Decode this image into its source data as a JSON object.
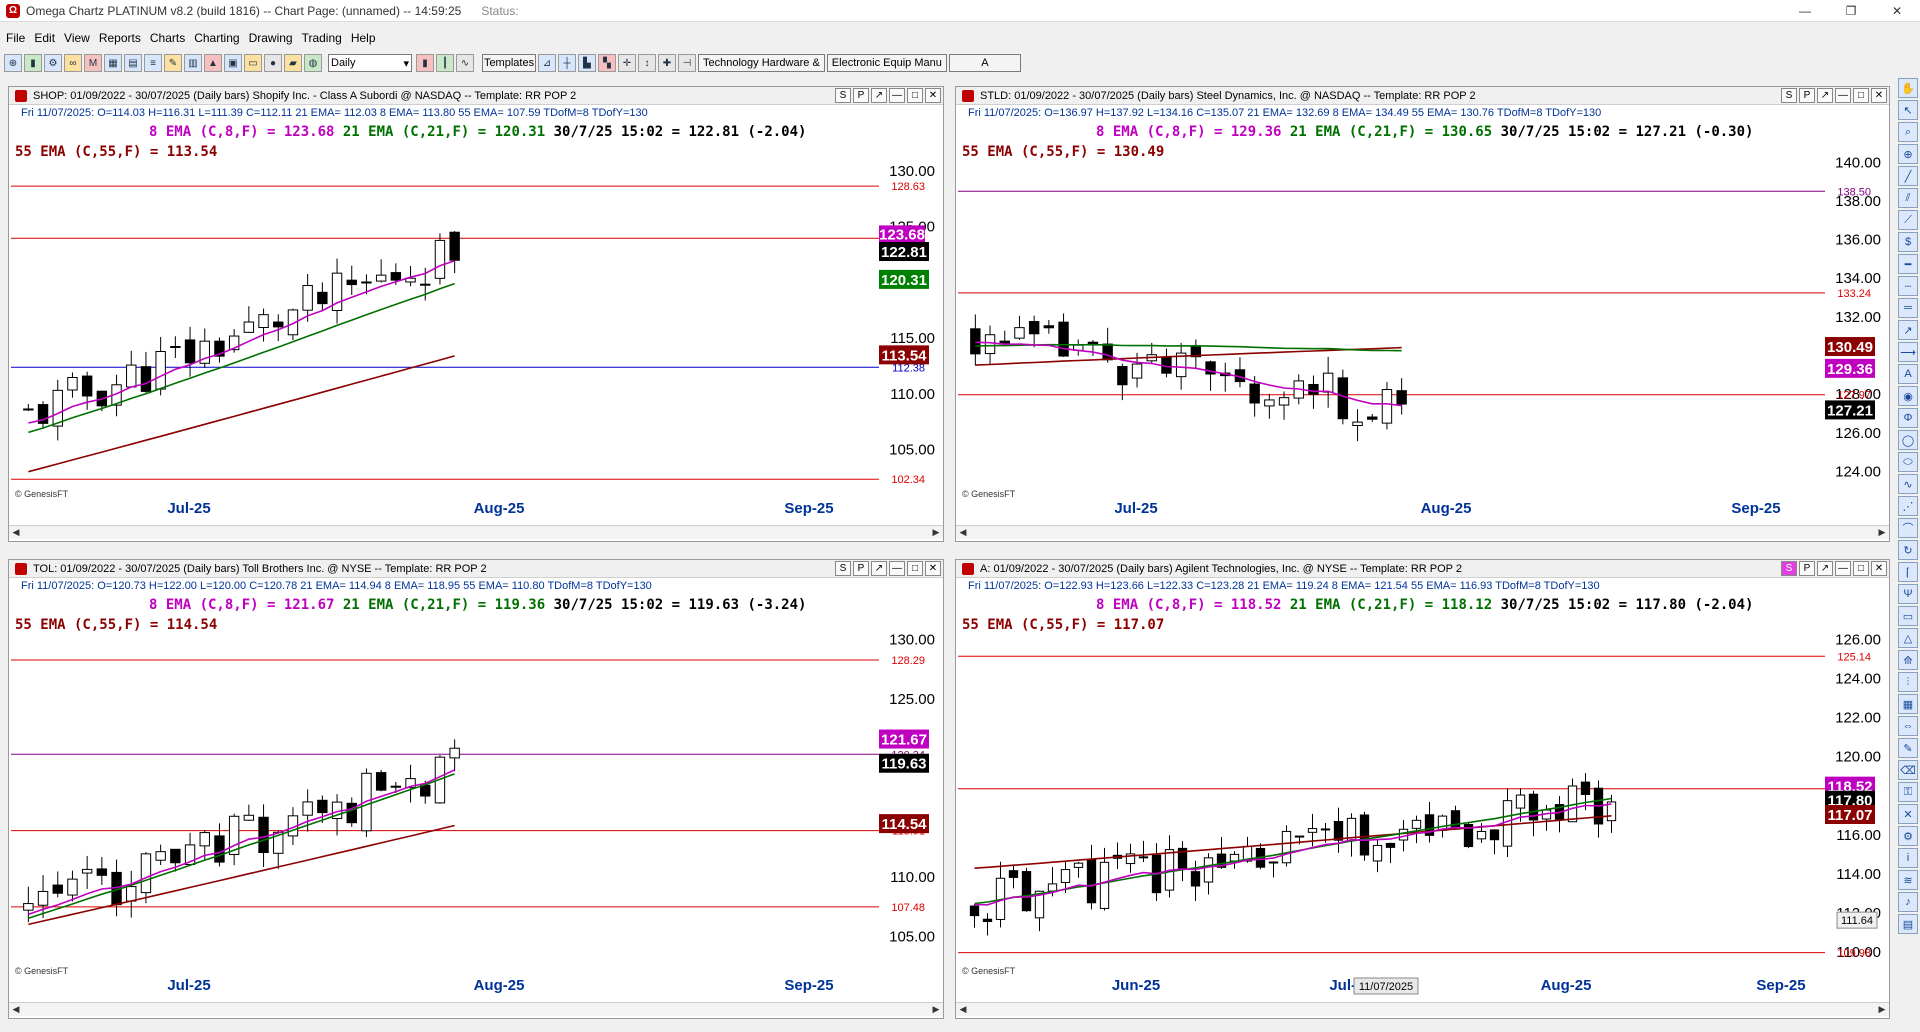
{
  "window": {
    "title": "Omega Chartz PLATINUM v8.2 (build 1816)  --  Chart Page: (unnamed) --  14:59:25",
    "status_label": "Status:"
  },
  "menu": [
    "File",
    "Edit",
    "View",
    "Reports",
    "Charts",
    "Charting",
    "Drawing",
    "Trading",
    "Help"
  ],
  "toolbar": {
    "interval": "Daily",
    "templates_label": "Templates",
    "industry_label": "Technology Hardware &",
    "subindustry_label": "Electronic Equip Manu",
    "symbol": "A"
  },
  "panels": [
    {
      "header": "SHOP:  01/09/2022 - 30/07/2025  (Daily bars)   Shopify Inc. - Class A Subordi @ NASDAQ  --  Template: RR POP 2",
      "stats": "Fri   11/07/2025:  O=114.03  H=116.31  L=111.39  C=112.11  21 EMA= 112.03  8 EMA= 113.80  55 EMA= 107.59  TDofM=8  TDofY=130",
      "ema8": "8 EMA (C,8,F) = 123.68",
      "ema21": "21 EMA (C,21,F) = 120.31",
      "last": "30/7/25 15:02 = 122.81 (-2.04)",
      "ema55": "55 EMA (C,55,F) = 113.54",
      "buttons": [
        "S",
        "P",
        "↗"
      ],
      "credit": "© GenesisFT",
      "ymin": 102,
      "ymax": 132.5,
      "yticks": [
        105,
        110,
        115,
        125,
        130
      ],
      "ytick_labels": [
        "105.00",
        "110.00",
        "115.00",
        "125.00",
        "130.00"
      ],
      "dates": [
        "Jul-25",
        "Aug-25",
        "Sep-25"
      ],
      "hlines": [
        {
          "value": 128.63,
          "label": "128.63",
          "color": "#dd0000"
        },
        {
          "value": 123.95,
          "label": "123.95",
          "color": "#dd0000"
        },
        {
          "value": 112.38,
          "label": "112.38",
          "color": "#0000cc"
        },
        {
          "value": 102.34,
          "label": "102.34",
          "color": "#dd0000"
        }
      ],
      "badges": [
        {
          "value": 122.81,
          "label": "122.81",
          "color": "#000000"
        },
        {
          "value": 120.31,
          "label": "120.31",
          "color": "#008000"
        },
        {
          "value": 113.54,
          "label": "113.54",
          "color": "#8b0000"
        }
      ],
      "badge_partial": {
        "value": 124.3,
        "label": "123.68",
        "color": "#c000c0"
      },
      "start": 108.0,
      "end": 122.81,
      "bars": 30,
      "seed": 11,
      "e21": [
        106.5,
        120.31
      ],
      "e55": [
        103.0,
        113.54
      ]
    },
    {
      "header": "STLD:  01/09/2022 - 30/07/2025  (Daily bars)   Steel Dynamics, Inc. @ NASDAQ  --  Template: RR POP 2",
      "stats": "Fri   11/07/2025:  O=136.97  H=137.92  L=134.16  C=135.07  21 EMA= 132.69  8 EMA= 134.49  55 EMA= 130.76  TDofM=8  TDofY=130",
      "ema8": "8 EMA (C,8,F) = 129.36",
      "ema21": "21 EMA (C,21,F) = 130.65",
      "last": "30/7/25 15:02 = 127.21 (-0.30)",
      "ema55": "55 EMA (C,55,F) = 130.49",
      "buttons": [
        "S",
        "P",
        "↗"
      ],
      "credit": "© GenesisFT",
      "ymin": 123.4,
      "ymax": 141,
      "yticks": [
        124,
        126,
        128,
        130,
        132,
        134,
        136,
        138,
        140
      ],
      "ytick_labels": [
        "124.00",
        "126.00",
        "128.00",
        "",
        "132.00",
        "134.00",
        "136.00",
        "138.00",
        "140.00"
      ],
      "dates": [
        "Jul-25",
        "Aug-25",
        "Sep-25"
      ],
      "hlines": [
        {
          "value": 138.5,
          "label": "138.50",
          "color": "#800080"
        },
        {
          "value": 133.24,
          "label": "133.24",
          "color": "#dd0000"
        },
        {
          "value": 127.97,
          "label": "127.97",
          "color": "#dd0000"
        }
      ],
      "badges": [
        {
          "value": 130.49,
          "label": "130.49",
          "color": "#8b0000"
        },
        {
          "value": 129.36,
          "label": "129.36",
          "color": "#c000c0"
        },
        {
          "value": 127.21,
          "label": "127.21",
          "color": "#000000"
        }
      ],
      "start": 131.0,
      "end": 127.21,
      "bars": 30,
      "seed": 23,
      "e21": [
        130.5,
        130.65
      ],
      "e55": [
        129.5,
        130.49
      ]
    },
    {
      "header": "TOL:  01/09/2022 - 30/07/2025  (Daily bars)   Toll Brothers Inc. @ NYSE  --  Template: RR POP 2",
      "stats": "Fri   11/07/2025:  O=120.73  H=122.00  L=120.00  C=120.78  21 EMA= 114.94  8 EMA= 118.95  55 EMA= 110.80  TDofM=8  TDofY=130",
      "ema8": "8 EMA (C,8,F) = 121.67",
      "ema21": "21 EMA (C,21,F) = 119.36",
      "last": "30/7/25 15:02 = 119.63 (-3.24)",
      "ema55": "55 EMA (C,55,F) = 114.54",
      "buttons": [
        "S",
        "P",
        "↗"
      ],
      "credit": "© GenesisFT",
      "ymin": 103,
      "ymax": 132,
      "yticks": [
        105,
        110,
        120,
        125,
        130
      ],
      "ytick_labels": [
        "105.00",
        "110.00",
        "",
        "125.00",
        "130.00"
      ],
      "dates": [
        "Jul-25",
        "Aug-25",
        "Sep-25"
      ],
      "hlines": [
        {
          "value": 128.29,
          "label": "128.29",
          "color": "#dd0000"
        },
        {
          "value": 120.34,
          "label": "120.34",
          "color": "#800080"
        },
        {
          "value": 113.91,
          "label": "113.91",
          "color": "#dd0000"
        },
        {
          "value": 107.48,
          "label": "107.48",
          "color": "#dd0000"
        }
      ],
      "badges": [
        {
          "value": 121.67,
          "label": "121.67",
          "color": "#c000c0"
        },
        {
          "value": 119.63,
          "label": "119.63",
          "color": "#000000"
        },
        {
          "value": 114.54,
          "label": "114.54",
          "color": "#8b0000"
        }
      ],
      "start": 107.0,
      "end": 119.63,
      "bars": 30,
      "seed": 37,
      "e21": [
        106.5,
        119.36
      ],
      "e55": [
        106.0,
        114.54
      ]
    },
    {
      "header": "A:  01/09/2022 - 30/07/2025  (Daily bars)   Agilent Technologies, Inc. @ NYSE  --  Template: RR POP 2",
      "stats": "Fri   11/07/2025:  O=122.93  H=123.66  L=122.33  C=123.28  21 EMA= 119.24  8 EMA= 121.54  55 EMA= 116.93  TDofM=8  TDofY=130",
      "ema8": "8 EMA (C,8,F) = 118.52",
      "ema21": "21 EMA (C,21,F) = 118.12",
      "last": "30/7/25 15:02 = 117.80 (-2.04)",
      "ema55": "55 EMA (C,55,F) = 117.07",
      "buttons": [
        "S",
        "P",
        "↗"
      ],
      "credit": "© GenesisFT",
      "ymin": 109.6,
      "ymax": 127.2,
      "yticks": [
        110,
        112,
        114,
        116,
        118,
        120,
        122,
        124,
        126
      ],
      "ytick_labels": [
        "110.00",
        "112.00",
        "114.00",
        "116.00",
        "",
        "120.00",
        "122.00",
        "124.00",
        "126.00"
      ],
      "dates": [
        "Jun-25",
        "Jul-25",
        "Aug-25",
        "Sep-25"
      ],
      "cursor_date": "11/07/2025",
      "cursor_price": "111.64",
      "hlines": [
        {
          "value": 125.14,
          "label": "125.14",
          "color": "#dd0000"
        },
        {
          "value": 118.36,
          "label": "118.36",
          "color": "#dd0000"
        },
        {
          "value": 109.98,
          "label": "109.98",
          "color": "#dd0000"
        }
      ],
      "badges": [
        {
          "value": 118.52,
          "label": "118.52",
          "color": "#c000c0"
        },
        {
          "value": 117.8,
          "label": "117.80",
          "color": "#000000"
        },
        {
          "value": 117.07,
          "label": "117.07",
          "color": "#8b0000"
        }
      ],
      "start": 112.5,
      "end": 117.8,
      "bars": 50,
      "seed": 51,
      "e21": [
        112.5,
        118.12
      ],
      "e55": [
        114.3,
        117.07
      ]
    }
  ]
}
